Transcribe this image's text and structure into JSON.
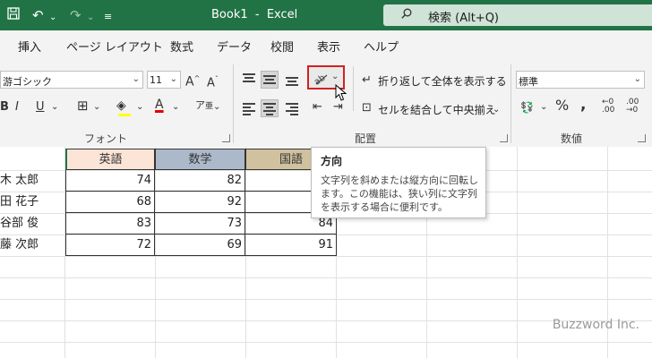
{
  "app": {
    "doc_title": "Book1  -  Excel",
    "search_placeholder": "検索 (Alt+Q)"
  },
  "tabs": [
    "挿入",
    "ページ レイアウト",
    "数式",
    "データ",
    "校閲",
    "表示",
    "ヘルプ"
  ],
  "ribbon": {
    "font_name": "游ゴシック",
    "font_size": "11",
    "font_group_label": "フォント",
    "wrap_text_label": "折り返して全体を表示する",
    "merge_center_label": "セルを結合して中央揃え",
    "alignment_group_label": "配置",
    "number_format": "標準",
    "number_group_label": "数値"
  },
  "sheet": {
    "headers": [
      "英語",
      "数学",
      "国語"
    ],
    "header_colors": [
      "#fce4d6",
      "#acb9ca",
      "#d0c29f"
    ],
    "rows": [
      {
        "name": "木 太郎",
        "values": [
          "74",
          "82",
          ""
        ]
      },
      {
        "name": "田 花子",
        "values": [
          "68",
          "92",
          ""
        ]
      },
      {
        "name": "谷部 俊",
        "values": [
          "83",
          "73",
          "84"
        ]
      },
      {
        "name": "藤 次郎",
        "values": [
          "72",
          "69",
          "91"
        ]
      }
    ]
  },
  "tooltip": {
    "title": "方向",
    "lines": [
      "文字列を斜めまたは縦方向に回転し",
      "ます。この機能は、狭い列に文字列",
      "を表示する場合に便利です。"
    ]
  },
  "watermark": "Buzzword Inc.",
  "accent_color": "#217346"
}
